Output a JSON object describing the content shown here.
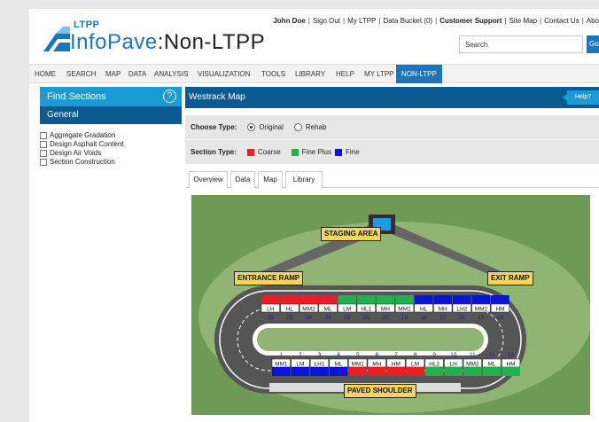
{
  "header": {
    "logo_ltpp": "LTPP",
    "logo_main": "InfoPave",
    "logo_colon": ":",
    "logo_sub": "Non-LTPP",
    "user": "John Doe",
    "links": [
      "Sign Out",
      "My LTPP",
      "Data Bucket (0)"
    ],
    "customer_support": "Customer Support",
    "links2": [
      "Site Map",
      "Contact Us",
      "Abo"
    ],
    "search_placeholder": "Search",
    "go_label": "Go"
  },
  "nav": {
    "items": [
      "HOME",
      "SEARCH",
      "MAP",
      "DATA",
      "ANALYSIS",
      "VISUALIZATION",
      "TOOLS",
      "LIBRARY",
      "HELP",
      "MY LTPP",
      "NON-LTPP"
    ],
    "active": "NON-LTPP"
  },
  "sidebar": {
    "title": "Find Sections",
    "help_icon": "?",
    "section": "General",
    "items": [
      "Aggregate Gradation",
      "Design Asphalt Content",
      "Design Air Voids",
      "Section Construction"
    ]
  },
  "main": {
    "title": "Westrack Map",
    "help_label": "Help?",
    "choose_type_label": "Choose Type:",
    "type_options": [
      "Original",
      "Rehab"
    ],
    "type_selected": "Original",
    "section_type_label": "Section Type:",
    "section_types": [
      {
        "label": "Coarse",
        "color": "#ee1c25"
      },
      {
        "label": "Fine Plus",
        "color": "#22b14c"
      },
      {
        "label": "Fine",
        "color": "#0a14d8"
      }
    ],
    "tabs": [
      "Overview",
      "Data",
      "Map",
      "Library"
    ],
    "active_tab": "Map"
  },
  "map": {
    "staging_area": "STAGING AREA",
    "entrance_ramp": "ENTRANCE RAMP",
    "exit_ramp": "EXIT RAMP",
    "paved_shoulder": "PAVED SHOULDER",
    "top_sections": [
      {
        "num": "26",
        "code": "LH",
        "color": "#ee1c25"
      },
      {
        "num": "25",
        "code": "HL",
        "color": "#ee1c25"
      },
      {
        "num": "24",
        "code": "MM2",
        "color": "#ee1c25"
      },
      {
        "num": "23",
        "code": "ML",
        "color": "#ee1c25"
      },
      {
        "num": "22",
        "code": "LM",
        "color": "#22b14c"
      },
      {
        "num": "21",
        "code": "HL1",
        "color": "#22b14c"
      },
      {
        "num": "20",
        "code": "MH",
        "color": "#22b14c"
      },
      {
        "num": "19",
        "code": "MM1",
        "color": "#22b14c"
      },
      {
        "num": "18",
        "code": "HL",
        "color": "#0a14d8"
      },
      {
        "num": "17",
        "code": "MH",
        "color": "#0a14d8"
      },
      {
        "num": "16",
        "code": "LH2",
        "color": "#0a14d8"
      },
      {
        "num": "15",
        "code": "MM2",
        "color": "#0a14d8"
      },
      {
        "num": "14",
        "code": "HM",
        "color": "#0a14d8"
      }
    ],
    "bottom_sections": [
      {
        "num": "1",
        "code": "MM1",
        "color": "#0a14d8"
      },
      {
        "num": "2",
        "code": "LM",
        "color": "#0a14d8"
      },
      {
        "num": "3",
        "code": "LH1",
        "color": "#0a14d8"
      },
      {
        "num": "4",
        "code": "ML",
        "color": "#0a14d8"
      },
      {
        "num": "5",
        "code": "MM1",
        "color": "#ee1c25"
      },
      {
        "num": "6",
        "code": "MH",
        "color": "#ee1c25"
      },
      {
        "num": "7",
        "code": "HM",
        "color": "#ee1c25"
      },
      {
        "num": "8",
        "code": "LM",
        "color": "#ee1c25"
      },
      {
        "num": "9",
        "code": "HL2",
        "color": "#22b14c"
      },
      {
        "num": "10",
        "code": "LH",
        "color": "#22b14c"
      },
      {
        "num": "11",
        "code": "MM2",
        "color": "#22b14c"
      },
      {
        "num": "12",
        "code": "ML",
        "color": "#22b14c"
      },
      {
        "num": "13",
        "code": "HM",
        "color": "#22b14c"
      }
    ]
  }
}
